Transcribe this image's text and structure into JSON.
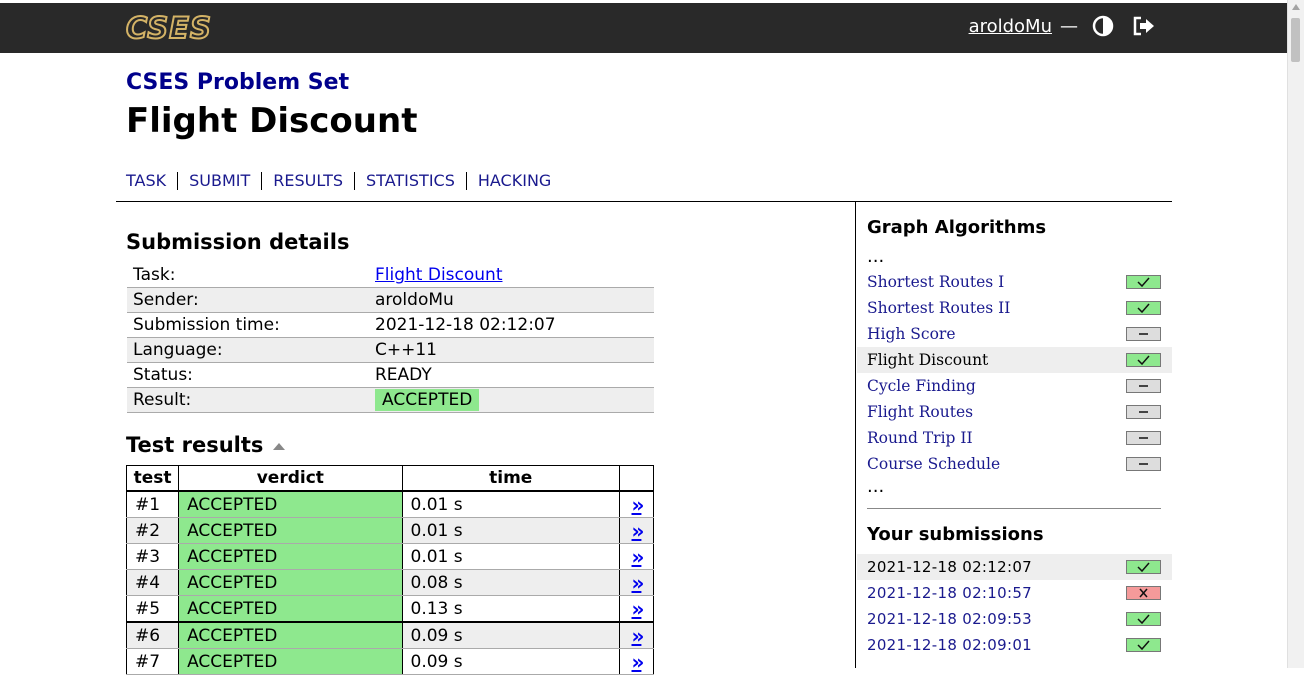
{
  "header": {
    "logo": "CSES",
    "username": "aroldoMu",
    "separator": "—",
    "theme_icon": "half-circle-contrast-icon",
    "logout_icon": "logout-arrow-icon"
  },
  "site_title": "CSES Problem Set",
  "page_title": "Flight Discount",
  "nav": [
    "TASK",
    "SUBMIT",
    "RESULTS",
    "STATISTICS",
    "HACKING"
  ],
  "submission": {
    "title": "Submission details",
    "rows": [
      {
        "label": "Task:",
        "value": "Flight Discount"
      },
      {
        "label": "Sender:",
        "value": "aroldoMu"
      },
      {
        "label": "Submission time:",
        "value": "2021-12-18 02:12:07"
      },
      {
        "label": "Language:",
        "value": "C++11"
      },
      {
        "label": "Status:",
        "value": "READY"
      },
      {
        "label": "Result:",
        "value": "ACCEPTED"
      }
    ]
  },
  "tests": {
    "title": "Test results",
    "headers": [
      "test",
      "verdict",
      "time"
    ],
    "link_glyph": "»",
    "rows": [
      {
        "id": "#1",
        "verdict": "ACCEPTED",
        "time": "0.01 s"
      },
      {
        "id": "#2",
        "verdict": "ACCEPTED",
        "time": "0.01 s"
      },
      {
        "id": "#3",
        "verdict": "ACCEPTED",
        "time": "0.01 s"
      },
      {
        "id": "#4",
        "verdict": "ACCEPTED",
        "time": "0.08 s"
      },
      {
        "id": "#5",
        "verdict": "ACCEPTED",
        "time": "0.13 s"
      },
      {
        "id": "#6",
        "verdict": "ACCEPTED",
        "time": "0.09 s"
      },
      {
        "id": "#7",
        "verdict": "ACCEPTED",
        "time": "0.09 s"
      }
    ]
  },
  "sidebar": {
    "category_title": "Graph Algorithms",
    "ellipsis": "...",
    "tasks": [
      {
        "name": "Shortest Routes I",
        "status": "ok"
      },
      {
        "name": "Shortest Routes II",
        "status": "ok"
      },
      {
        "name": "High Score",
        "status": "none"
      },
      {
        "name": "Flight Discount",
        "status": "ok",
        "current": true
      },
      {
        "name": "Cycle Finding",
        "status": "none"
      },
      {
        "name": "Flight Routes",
        "status": "none"
      },
      {
        "name": "Round Trip II",
        "status": "none"
      },
      {
        "name": "Course Schedule",
        "status": "none"
      }
    ],
    "submissions_title": "Your submissions",
    "submissions": [
      {
        "time": "2021-12-18 02:12:07",
        "status": "ok",
        "current": true
      },
      {
        "time": "2021-12-18 02:10:57",
        "status": "fail"
      },
      {
        "time": "2021-12-18 02:09:53",
        "status": "ok"
      },
      {
        "time": "2021-12-18 02:09:01",
        "status": "ok"
      }
    ]
  },
  "colors": {
    "topbar": "#292929",
    "accent_blue": "#00008b",
    "accepted_green": "#8ee88e",
    "fail_red": "#f59a9a"
  }
}
